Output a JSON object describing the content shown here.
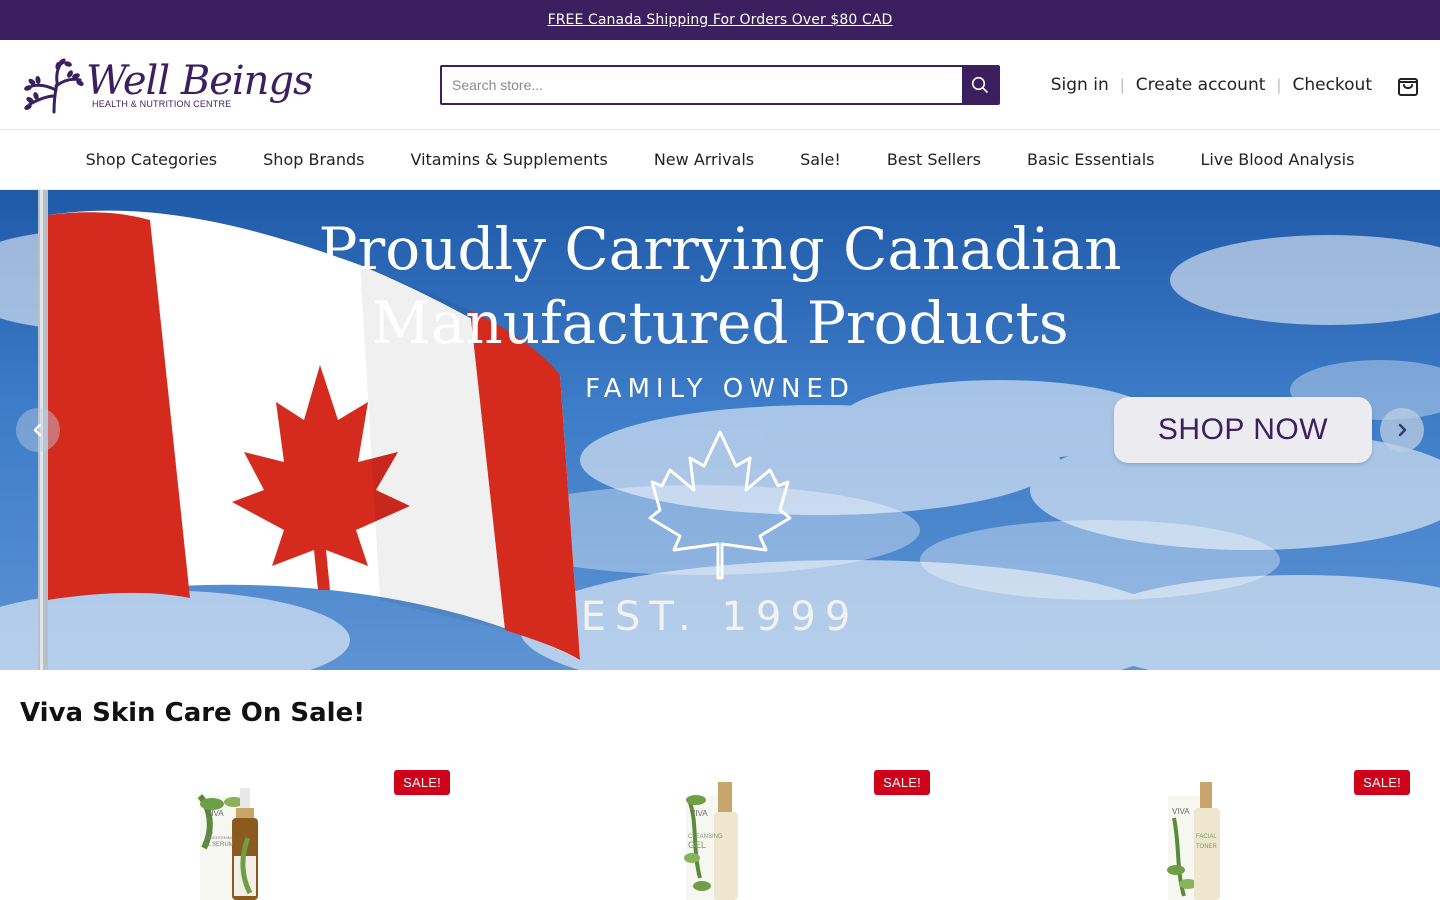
{
  "announcement": {
    "text": "FREE Canada Shipping For Orders Over $80 CAD"
  },
  "brand": {
    "name": "Well Beings",
    "tagline": "HEALTH & NUTRITION CENTRE",
    "color": "#3b1f5e"
  },
  "search": {
    "placeholder": "Search store..."
  },
  "account": {
    "sign_in": "Sign in",
    "create_account": "Create account",
    "checkout": "Checkout",
    "separator": "|"
  },
  "nav": {
    "items": [
      "Shop Categories",
      "Shop Brands",
      "Vitamins & Supplements",
      "New Arrivals",
      "Sale!",
      "Best Sellers",
      "Basic Essentials",
      "Live Blood Analysis"
    ]
  },
  "hero": {
    "title_line1": "Proudly Carrying Canadian",
    "title_line2": "Manufactured Products",
    "subtitle": "FAMILY OWNED",
    "established": "EST. 1999",
    "cta": "SHOP NOW"
  },
  "section": {
    "title": "Viva Skin Care On Sale!"
  },
  "products": [
    {
      "badge": "SALE!",
      "label_brand": "VIVA",
      "label_line1": "BIO",
      "label_line2": "BRIGHTENING",
      "label_line3": "C SERUM"
    },
    {
      "badge": "SALE!",
      "label_brand": "VIVA",
      "label_line1": "CLEANSING",
      "label_line2": "GEL",
      "label_line3": ""
    },
    {
      "badge": "SALE!",
      "label_brand": "VIVA",
      "label_line1": "FACIAL",
      "label_line2": "TONER",
      "label_line3": ""
    }
  ]
}
